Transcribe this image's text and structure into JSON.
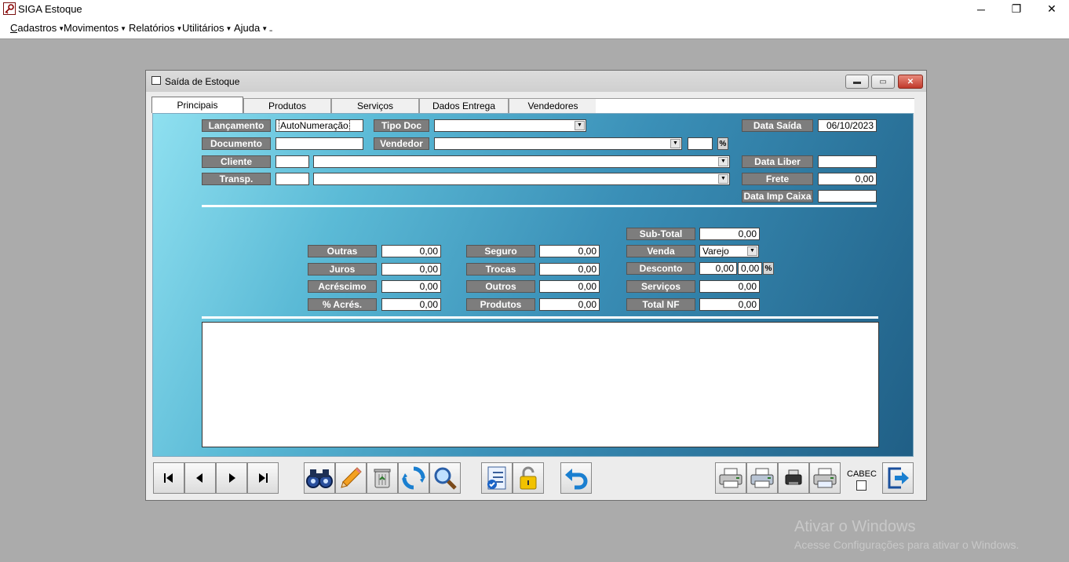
{
  "app": {
    "title": "SIGA Estoque"
  },
  "window_controls": {
    "minimize": "─",
    "restore": "❐",
    "close": "✕"
  },
  "menu": [
    {
      "label": "Cadastros"
    },
    {
      "label": "Movimentos"
    },
    {
      "label": "Relatórios"
    },
    {
      "label": "Utilitários"
    },
    {
      "label": "Ajuda"
    }
  ],
  "menu_extra": "ˍ",
  "child_window": {
    "title": "Saída de Estoque",
    "minimize": "▬",
    "restore": "▭",
    "close": "✕"
  },
  "tabs": [
    {
      "label": "Principais",
      "active": true
    },
    {
      "label": "Produtos"
    },
    {
      "label": "Serviços"
    },
    {
      "label": "Dados Entrega"
    },
    {
      "label": "Vendedores"
    }
  ],
  "form": {
    "lancamento": {
      "label": "Lançamento",
      "value": "AutoNumeração"
    },
    "tipo_doc": {
      "label": "Tipo Doc",
      "value": ""
    },
    "data_saida": {
      "label": "Data Saída",
      "value": "06/10/2023"
    },
    "documento": {
      "label": "Documento",
      "value": ""
    },
    "vendedor": {
      "label": "Vendedor",
      "value": "",
      "pct_value": "",
      "pct_symbol": "%"
    },
    "cliente": {
      "label": "Cliente",
      "code": "",
      "value": ""
    },
    "data_liber": {
      "label": "Data Liber",
      "value": ""
    },
    "transp": {
      "label": "Transp.",
      "code": "",
      "value": ""
    },
    "frete": {
      "label": "Frete",
      "value": "0,00"
    },
    "data_imp_caixa": {
      "label": "Data Imp Caixa",
      "value": ""
    }
  },
  "totals": {
    "outras": {
      "label": "Outras",
      "value": "0,00"
    },
    "juros": {
      "label": "Juros",
      "value": "0,00"
    },
    "acrescimo": {
      "label": "Acréscimo",
      "value": "0,00"
    },
    "pct_acres": {
      "label": "% Acrés.",
      "value": "0,00"
    },
    "seguro": {
      "label": "Seguro",
      "value": "0,00"
    },
    "trocas": {
      "label": "Trocas",
      "value": "0,00"
    },
    "outros": {
      "label": "Outros",
      "value": "0,00"
    },
    "produtos": {
      "label": "Produtos",
      "value": "0,00"
    },
    "sub_total": {
      "label": "Sub-Total",
      "value": "0,00"
    },
    "venda": {
      "label": "Venda",
      "value": "Varejo"
    },
    "desconto": {
      "label": "Desconto",
      "value": "0,00",
      "pct_value": "0,00",
      "pct_symbol": "%"
    },
    "servicos": {
      "label": "Serviços",
      "value": "0,00"
    },
    "total_nf": {
      "label": "Total NF",
      "value": "0,00"
    }
  },
  "notes": {
    "value": ""
  },
  "toolbar": {
    "icons": [
      "first-icon",
      "previous-icon",
      "next-icon",
      "last-icon",
      "binoculars-icon",
      "pencil-icon",
      "trash-icon",
      "refresh-icon",
      "magnifier-icon",
      "checklist-icon",
      "padlock-icon",
      "undo-icon",
      "printer-icon",
      "printer-icon",
      "small-printer-icon",
      "printer-icon",
      "exit-icon"
    ],
    "cabec_label": "CABEC",
    "cabec_checked": false
  },
  "watermark": {
    "line1": "Ativar o Windows",
    "line2": "Acesse Configurações para ativar o Windows."
  }
}
